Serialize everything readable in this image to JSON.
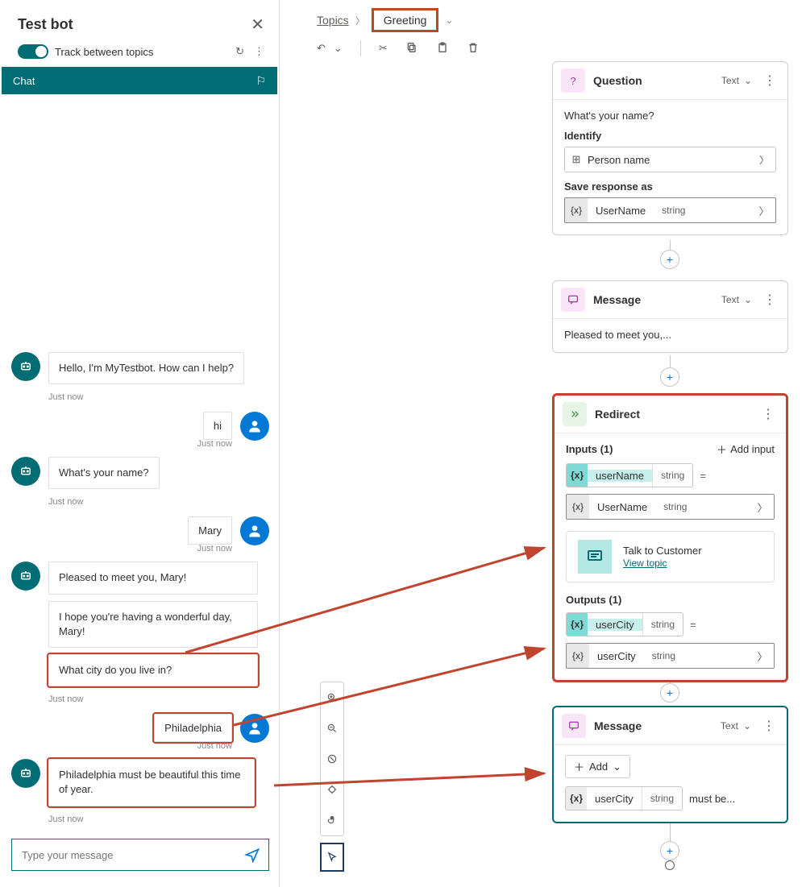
{
  "testbot": {
    "title": "Test bot",
    "trackLabel": "Track between topics",
    "chatTab": "Chat",
    "inputPlaceholder": "Type your message",
    "messages": {
      "bot1": "Hello, I'm MyTestbot. How can I help?",
      "bot1_ts": "Just now",
      "user1": "hi",
      "user1_ts": "Just now",
      "bot2": "What's your name?",
      "bot2_ts": "Just now",
      "user2": "Mary",
      "user2_ts": "Just now",
      "bot3a": "Pleased to meet you, Mary!",
      "bot3b": "I hope you're having a wonderful day, Mary!",
      "bot3c": "What city do you live in?",
      "bot3_ts": "Just now",
      "user3": "Philadelphia",
      "user3_ts": "Just now",
      "bot4": "Philadelphia must be beautiful this time of year.",
      "bot4_ts": "Just now"
    }
  },
  "breadcrumb": {
    "root": "Topics",
    "current": "Greeting"
  },
  "question": {
    "title": "Question",
    "typeLabel": "Text",
    "prompt": "What's your name?",
    "identifyLabel": "Identify",
    "identifyValue": "Person name",
    "saveLabel": "Save response as",
    "varName": "UserName",
    "varType": "string"
  },
  "message1": {
    "title": "Message",
    "typeLabel": "Text",
    "text": "Pleased to meet you,..."
  },
  "redirect": {
    "title": "Redirect",
    "inputsLabel": "Inputs (1)",
    "addInput": "Add input",
    "inVarLower": "userName",
    "inType": "string",
    "inVar": "UserName",
    "topicTitle": "Talk to Customer",
    "viewTopic": "View topic",
    "outputsLabel": "Outputs (1)",
    "outVarLower": "userCity",
    "outType": "string",
    "outVar": "userCity"
  },
  "message2": {
    "title": "Message",
    "typeLabel": "Text",
    "addLabel": "Add",
    "varName": "userCity",
    "varType": "string",
    "tail": "must be..."
  }
}
